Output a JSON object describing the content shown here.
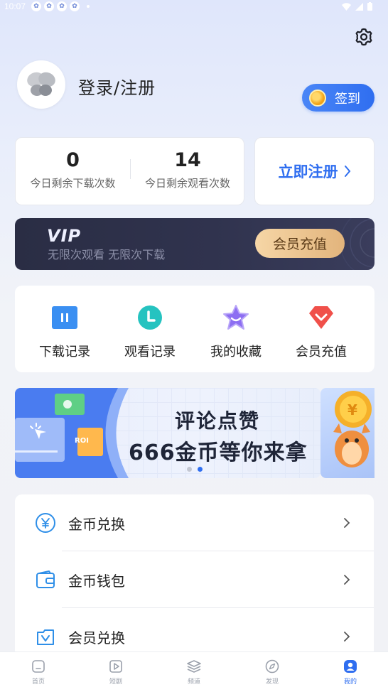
{
  "status_bar": {
    "time": "10:07"
  },
  "profile": {
    "login_text": "登录/注册",
    "checkin_label": "签到"
  },
  "stats": [
    {
      "value": "0",
      "label": "今日剩余下载次数"
    },
    {
      "value": "14",
      "label": "今日剩余观看次数"
    }
  ],
  "register_label": "立即注册",
  "vip": {
    "logo": "VIP",
    "subtitle": "无限次观看 无限次下载",
    "button": "会员充值"
  },
  "shortcuts": [
    {
      "label": "下载记录",
      "icon": "download-record-icon",
      "color": "#3a8ff2"
    },
    {
      "label": "观看记录",
      "icon": "watch-record-icon",
      "color": "#25c3c0"
    },
    {
      "label": "我的收藏",
      "icon": "favorites-star-icon",
      "color": "#8d6ef2"
    },
    {
      "label": "会员充值",
      "icon": "vip-recharge-icon",
      "color": "#f0504a"
    }
  ],
  "promo": {
    "line1": "评论点赞",
    "line2": "666金币等你来拿",
    "badge": "ROI"
  },
  "menu": [
    {
      "label": "金币兑换",
      "icon": "coin-exchange-icon"
    },
    {
      "label": "金币钱包",
      "icon": "wallet-icon"
    },
    {
      "label": "会员兑换",
      "icon": "vip-exchange-icon"
    }
  ],
  "tabs": [
    {
      "label": "首页",
      "icon": "home-icon"
    },
    {
      "label": "短剧",
      "icon": "short-drama-icon"
    },
    {
      "label": "频道",
      "icon": "channel-icon"
    },
    {
      "label": "发现",
      "icon": "discover-icon"
    },
    {
      "label": "我的",
      "icon": "profile-icon",
      "active": true
    }
  ],
  "colors": {
    "accent": "#2f6ef0",
    "vip_bg": "#2a2d44",
    "vip_gold": "#f6d6a6"
  }
}
